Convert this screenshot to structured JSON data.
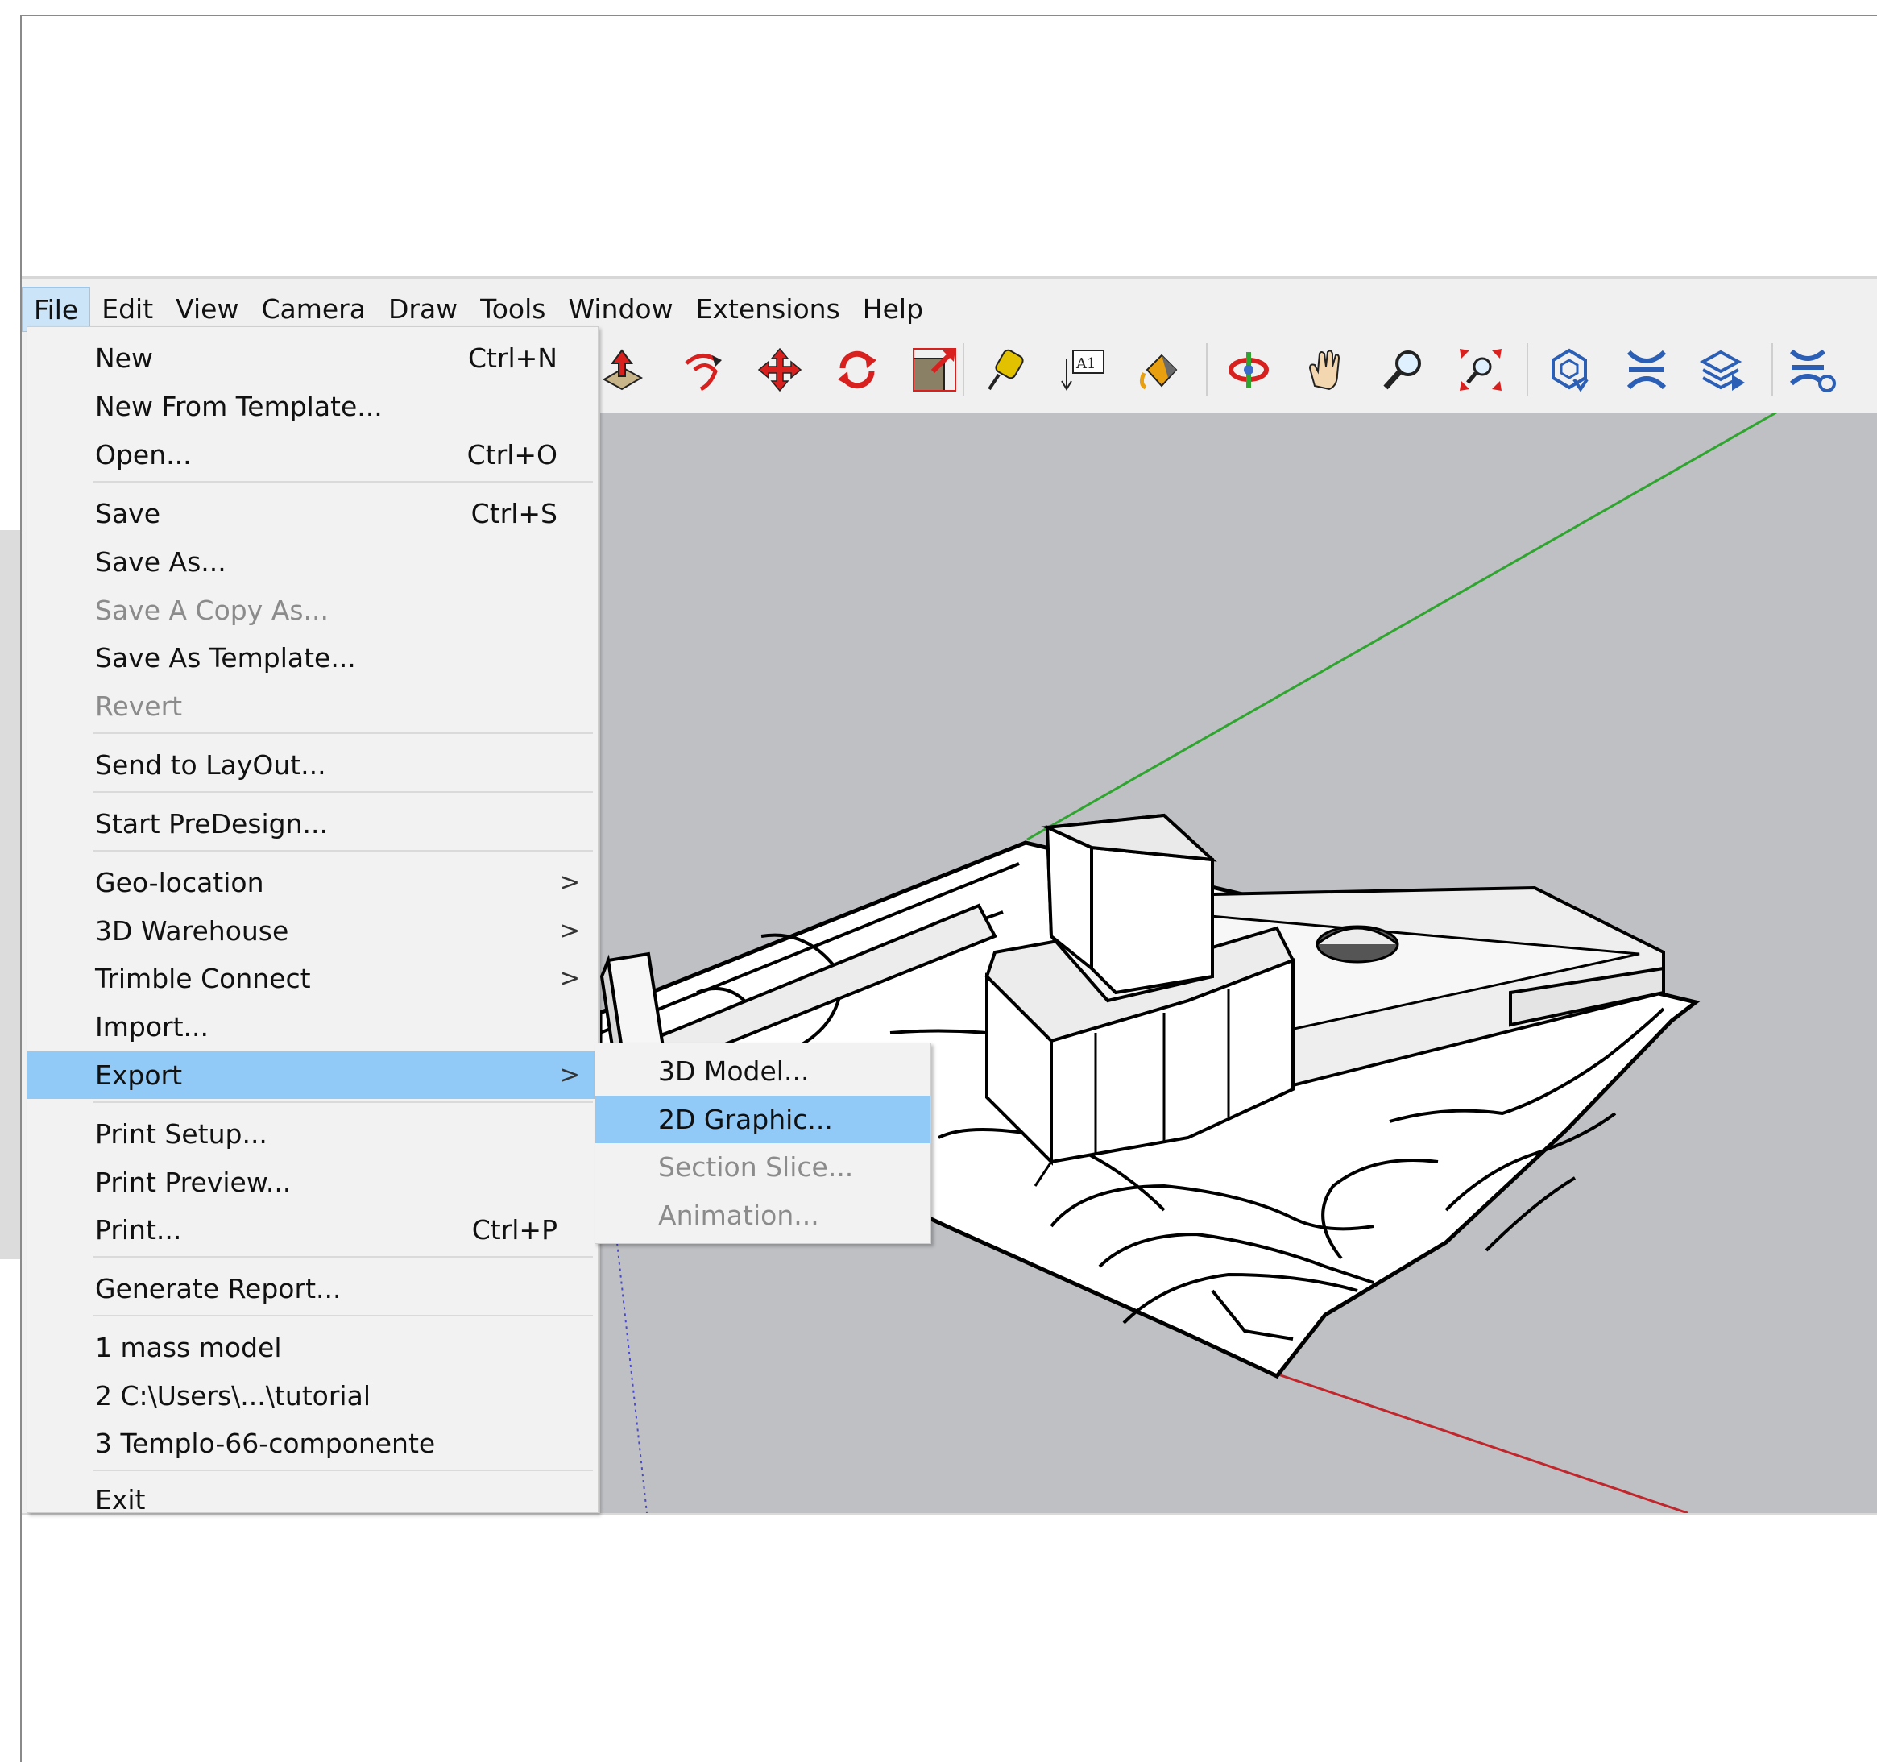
{
  "menubar": {
    "items": [
      "File",
      "Edit",
      "View",
      "Camera",
      "Draw",
      "Tools",
      "Window",
      "Extensions",
      "Help"
    ],
    "active": "File"
  },
  "toolbar": {
    "icons": [
      "push-pull-icon",
      "follow-me-icon",
      "move-icon",
      "rotate-icon",
      "scale-icon",
      "tape-measure-icon",
      "text-icon",
      "paint-bucket-icon",
      "orbit-icon",
      "pan-icon",
      "zoom-icon",
      "zoom-extents-icon",
      "warehouse-icon",
      "extension-warehouse-icon",
      "share-component-icon",
      "extension-manager-icon"
    ],
    "text_tool_label": "A1"
  },
  "file_menu": {
    "new": {
      "label": "New",
      "shortcut": "Ctrl+N"
    },
    "new_from_template": {
      "label": "New From Template..."
    },
    "open": {
      "label": "Open...",
      "shortcut": "Ctrl+O"
    },
    "save": {
      "label": "Save",
      "shortcut": "Ctrl+S"
    },
    "save_as": {
      "label": "Save As..."
    },
    "save_copy_as": {
      "label": "Save A Copy As..."
    },
    "save_as_template": {
      "label": "Save As Template..."
    },
    "revert": {
      "label": "Revert"
    },
    "send_to_layout": {
      "label": "Send to LayOut..."
    },
    "start_predesign": {
      "label": "Start PreDesign..."
    },
    "geo_location": {
      "label": "Geo-location"
    },
    "warehouse_3d": {
      "label": "3D Warehouse"
    },
    "trimble_connect": {
      "label": "Trimble Connect"
    },
    "import": {
      "label": "Import..."
    },
    "export": {
      "label": "Export"
    },
    "print_setup": {
      "label": "Print Setup..."
    },
    "print_preview": {
      "label": "Print Preview..."
    },
    "print": {
      "label": "Print...",
      "shortcut": "Ctrl+P"
    },
    "generate_report": {
      "label": "Generate Report..."
    },
    "recent_1": {
      "label": "1 mass model"
    },
    "recent_2": {
      "label": "2 C:\\Users\\...\\tutorial"
    },
    "recent_3": {
      "label": "3 Templo-66-componente"
    },
    "exit": {
      "label": "Exit"
    },
    "submenu_arrow": ">"
  },
  "export_submenu": {
    "model_3d": {
      "label": "3D Model..."
    },
    "graphic_2d": {
      "label": "2D Graphic..."
    },
    "section_slice": {
      "label": "Section Slice..."
    },
    "animation": {
      "label": "Animation..."
    }
  },
  "colors": {
    "highlight": "#91c9f7",
    "active_menu": "#cce4f7",
    "viewport_bg": "#bfc0c4",
    "green_axis": "#2fa52f",
    "red_axis": "#c0262b",
    "blue_axis": "#4a4acb",
    "icon_red": "#d8201f"
  }
}
